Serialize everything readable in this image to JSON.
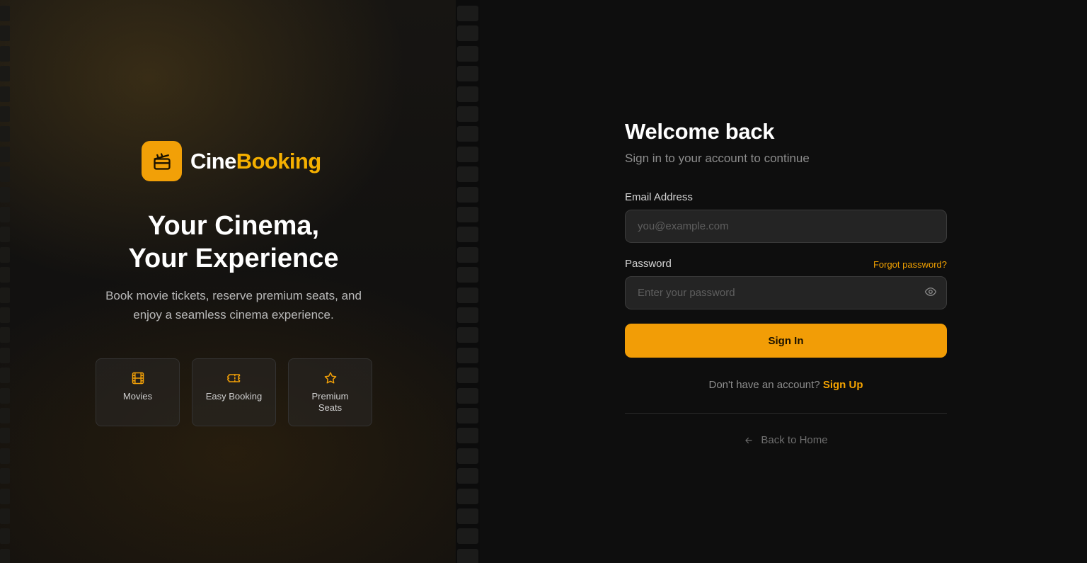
{
  "brand": {
    "name_part1": "Cine",
    "name_part2": "Booking",
    "logo_icon": "clapperboard-icon",
    "accent_color": "#f2a007"
  },
  "hero": {
    "title_line1": "Your Cinema,",
    "title_line2": "Your Experience",
    "subtitle_line1": "Book movie tickets, reserve premium seats, and",
    "subtitle_line2": "enjoy a seamless cinema experience."
  },
  "features": [
    {
      "icon": "film-icon",
      "label": "Movies"
    },
    {
      "icon": "ticket-icon",
      "label": "Easy Booking"
    },
    {
      "icon": "star-icon",
      "label": "Premium Seats"
    }
  ],
  "form": {
    "title": "Welcome back",
    "subtitle": "Sign in to your account to continue",
    "email_label": "Email Address",
    "email_placeholder": "you@example.com",
    "email_value": "",
    "password_label": "Password",
    "forgot_link": "Forgot password?",
    "password_placeholder": "Enter your password",
    "password_value": "",
    "password_toggle_icon": "eye-icon",
    "submit_label": "Sign In",
    "signup_prompt": "Don't have an account?",
    "signup_link": "Sign Up",
    "back_label": "Back to Home",
    "back_icon": "arrow-left-icon"
  }
}
